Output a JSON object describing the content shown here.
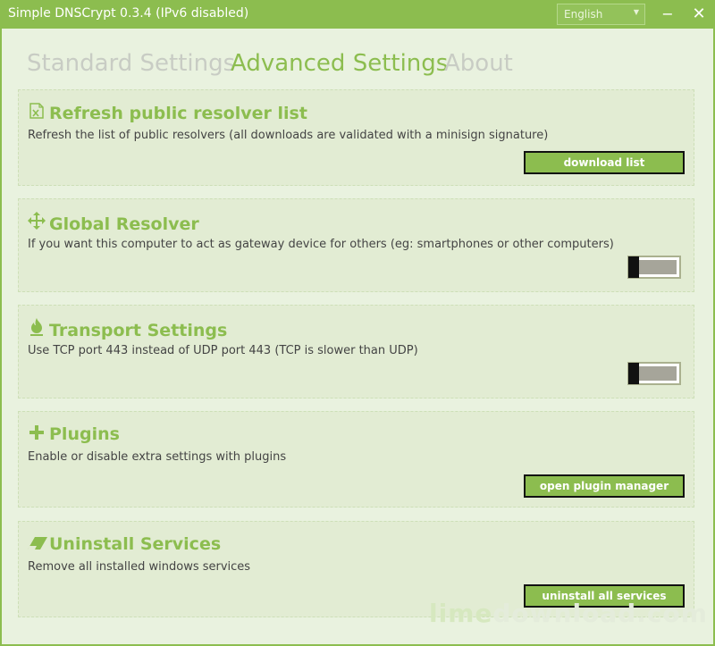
{
  "window": {
    "title": "Simple DNSCrypt 0.3.4 (IPv6 disabled)",
    "language_select": "English",
    "minimize_glyph": "−",
    "close_glyph": "✕"
  },
  "tabs": [
    {
      "label": "Standard Settings"
    },
    {
      "label": "Advanced Settings"
    },
    {
      "label": "About"
    }
  ],
  "sections": {
    "refresh": {
      "title": "Refresh public resolver list",
      "description": "Refresh the list of public resolvers (all downloads are validated with a minisign signature)",
      "button": "download list",
      "icon": "excel-file-icon"
    },
    "global_resolver": {
      "title": "Global Resolver",
      "description": "If you want this computer to act as gateway device for others (eg: smartphones or other computers)",
      "toggle_state": "off",
      "icon": "move-arrows-icon"
    },
    "transport": {
      "title": "Transport Settings",
      "description": "Use TCP port 443 instead of UDP port 443 (TCP is slower than UDP)",
      "toggle_state": "off",
      "icon": "fire-icon"
    },
    "plugins": {
      "title": "Plugins",
      "description": "Enable or disable extra settings with plugins",
      "button": "open plugin manager",
      "icon": "plus-icon"
    },
    "uninstall": {
      "title": "Uninstall Services",
      "description": "Remove all installed windows services",
      "button": "uninstall all services",
      "icon": "eraser-icon"
    }
  },
  "watermark": {
    "part1": "lime",
    "part2": "download.com"
  },
  "colors": {
    "accent": "#8cbd4f",
    "background": "#e9f2df",
    "card": "#e2ecd3"
  }
}
